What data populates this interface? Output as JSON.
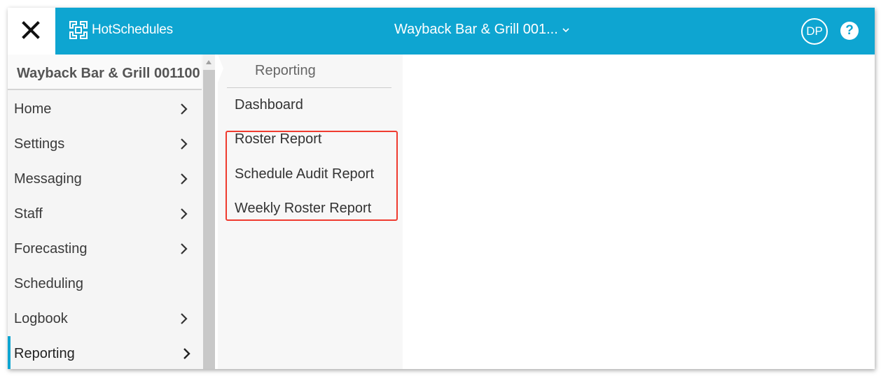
{
  "header": {
    "logo_text": "HotSchedules",
    "location": "Wayback Bar & Grill 001...",
    "avatar_initials": "DP",
    "help_symbol": "?",
    "accent_color": "#0ea5d1"
  },
  "sidebar": {
    "store_name": "Wayback Bar & Grill 001100",
    "items": [
      {
        "label": "Home"
      },
      {
        "label": "Settings"
      },
      {
        "label": "Messaging"
      },
      {
        "label": "Staff"
      },
      {
        "label": "Forecasting"
      },
      {
        "label": "Scheduling"
      },
      {
        "label": "Logbook"
      },
      {
        "label": "Reporting"
      }
    ]
  },
  "submenu": {
    "title": "Reporting",
    "items": [
      {
        "label": "Dashboard"
      },
      {
        "label": "Roster Report"
      },
      {
        "label": "Schedule Audit Report"
      },
      {
        "label": "Weekly Roster Report"
      }
    ],
    "highlight_color": "#ef3b2f"
  }
}
